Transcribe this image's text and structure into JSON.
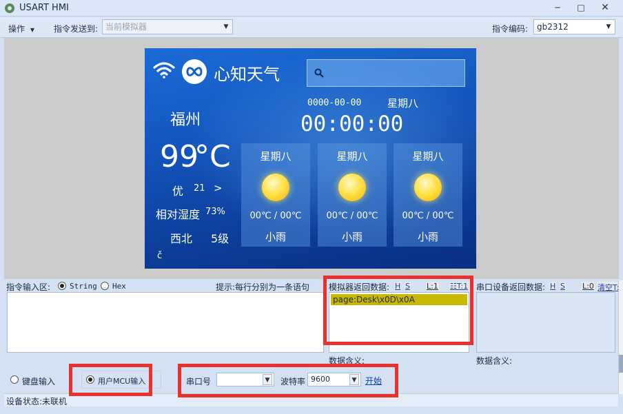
{
  "app": {
    "title": "USART HMI"
  },
  "toolbar": {
    "operation_label": "操作",
    "send_to_label": "指令发送到:",
    "send_to_value": "当前模拟器",
    "encoding_label": "指令编码:",
    "encoding_value": "gb2312"
  },
  "device": {
    "brand": "心知天气",
    "city": "福州",
    "date": "0000-00-00",
    "weekday": "星期八",
    "time": "00:00:00",
    "temperature": "99",
    "temp_unit": "°C",
    "aqi_level": "优",
    "aqi_value": "21",
    "aqi_arrow": ">",
    "humidity_label": "相对湿度",
    "humidity_value": "73%",
    "wind_dir": "西北",
    "wind_level": "5级",
    "corner_mark": "č",
    "forecast": [
      {
        "day": "星期八",
        "temp": "00℃ / 00℃",
        "cond": "小雨"
      },
      {
        "day": "星期八",
        "temp": "00℃ / 00℃",
        "cond": "小雨"
      },
      {
        "day": "星期八",
        "temp": "00℃ / 00℃",
        "cond": "小雨"
      }
    ]
  },
  "input_area": {
    "label": "指令输入区:",
    "mode_string": "String",
    "mode_hex": "Hex",
    "hint": "提示:每行分别为一条语句"
  },
  "sim_return": {
    "label": "模拟器返回数据:",
    "h": "H",
    "s": "S",
    "l": "L:1",
    "t": "☷T:1",
    "line": "page:Desk\\x0D\\x0A",
    "meaning_label": "数据含义:"
  },
  "serial_return": {
    "label": "串口设备返回数据:",
    "h": "H",
    "s": "S",
    "l": "L:0",
    "clear": "清空T:",
    "meaning_label": "数据含义:"
  },
  "input_mode": {
    "keyboard": "键盘输入",
    "user_mcu": "用户MCU输入"
  },
  "serial": {
    "port_label": "串口号",
    "port_value": "",
    "baud_label": "波特率",
    "baud_value": "9600",
    "start": "开始"
  },
  "status": {
    "text": "设备状态:未联机"
  },
  "colors": {
    "highlight_red": "#e8302d",
    "selection_yellow": "#c9b800",
    "device_blue": "#1457c0"
  }
}
